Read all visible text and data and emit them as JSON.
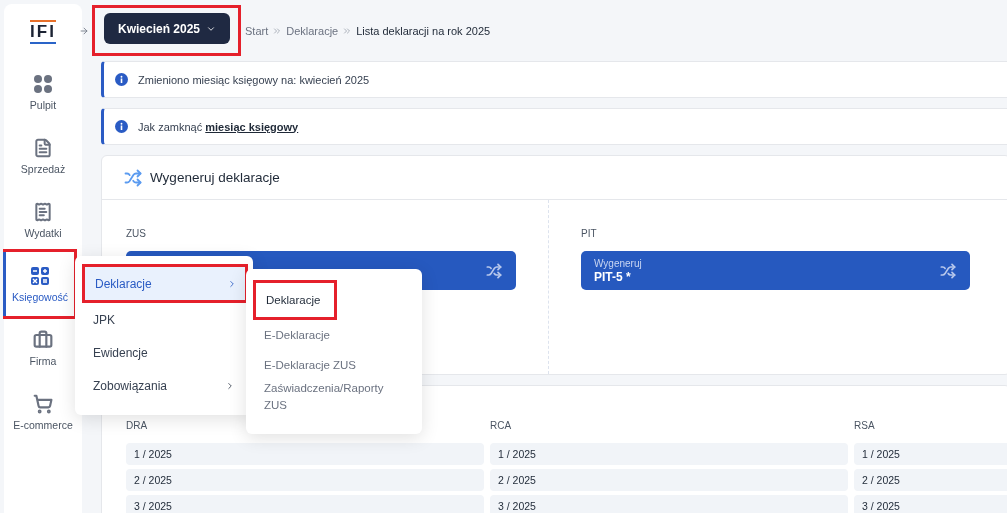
{
  "sidebar": {
    "logo": "IFI",
    "items": [
      {
        "label": "Pulpit",
        "selected": false,
        "highlighted": false
      },
      {
        "label": "Sprzedaż",
        "selected": false,
        "highlighted": false
      },
      {
        "label": "Wydatki",
        "selected": false,
        "highlighted": false
      },
      {
        "label": "Księgowość",
        "selected": true,
        "highlighted": true
      },
      {
        "label": "Firma",
        "selected": false,
        "highlighted": false
      },
      {
        "label": "E-commerce",
        "selected": false,
        "highlighted": false
      }
    ]
  },
  "month_button": {
    "label": "Kwiecień 2025",
    "highlighted": true
  },
  "breadcrumb": [
    {
      "label": "Start",
      "current": false
    },
    {
      "label": "Deklaracje",
      "current": false
    },
    {
      "label": "Lista deklaracji na rok 2025",
      "current": true
    }
  ],
  "alerts": [
    {
      "text": "Zmieniono miesiąc księgowy na: kwiecień 2025"
    },
    {
      "text": "Jak zamknąć",
      "link": "miesiąc księgowy"
    }
  ],
  "generate_card": {
    "title": "Wygeneruj deklaracje",
    "sections": [
      {
        "heading": "ZUS"
      },
      {
        "heading": "PIT",
        "caption": "Wygeneruj",
        "label": "PIT-5 *"
      }
    ]
  },
  "lists": [
    {
      "heading": "DRA",
      "rows": [
        "1 / 2025",
        "2 / 2025",
        "3 / 2025"
      ]
    },
    {
      "heading": "RCA",
      "rows": [
        "1 / 2025",
        "2 / 2025",
        "3 / 2025"
      ]
    },
    {
      "heading": "RSA",
      "rows": [
        "1 / 2025",
        "2 / 2025",
        "3 / 2025"
      ]
    }
  ],
  "menu": {
    "items": [
      {
        "label": "Deklaracje",
        "has_submenu": true,
        "selected": true,
        "highlighted": true
      },
      {
        "label": "JPK",
        "has_submenu": false,
        "selected": false,
        "highlighted": false
      },
      {
        "label": "Ewidencje",
        "has_submenu": false,
        "selected": false,
        "highlighted": false
      },
      {
        "label": "Zobowiązania",
        "has_submenu": true,
        "selected": false,
        "highlighted": false
      }
    ]
  },
  "submenu": {
    "items": [
      {
        "label": "Deklaracje",
        "selected": true,
        "highlighted": true
      },
      {
        "label": "E-Deklaracje",
        "selected": false,
        "highlighted": false
      },
      {
        "label": "E-Deklaracje ZUS",
        "selected": false,
        "highlighted": false
      },
      {
        "label": "Zaświadczenia/Raporty ZUS",
        "selected": false,
        "highlighted": false
      }
    ]
  }
}
